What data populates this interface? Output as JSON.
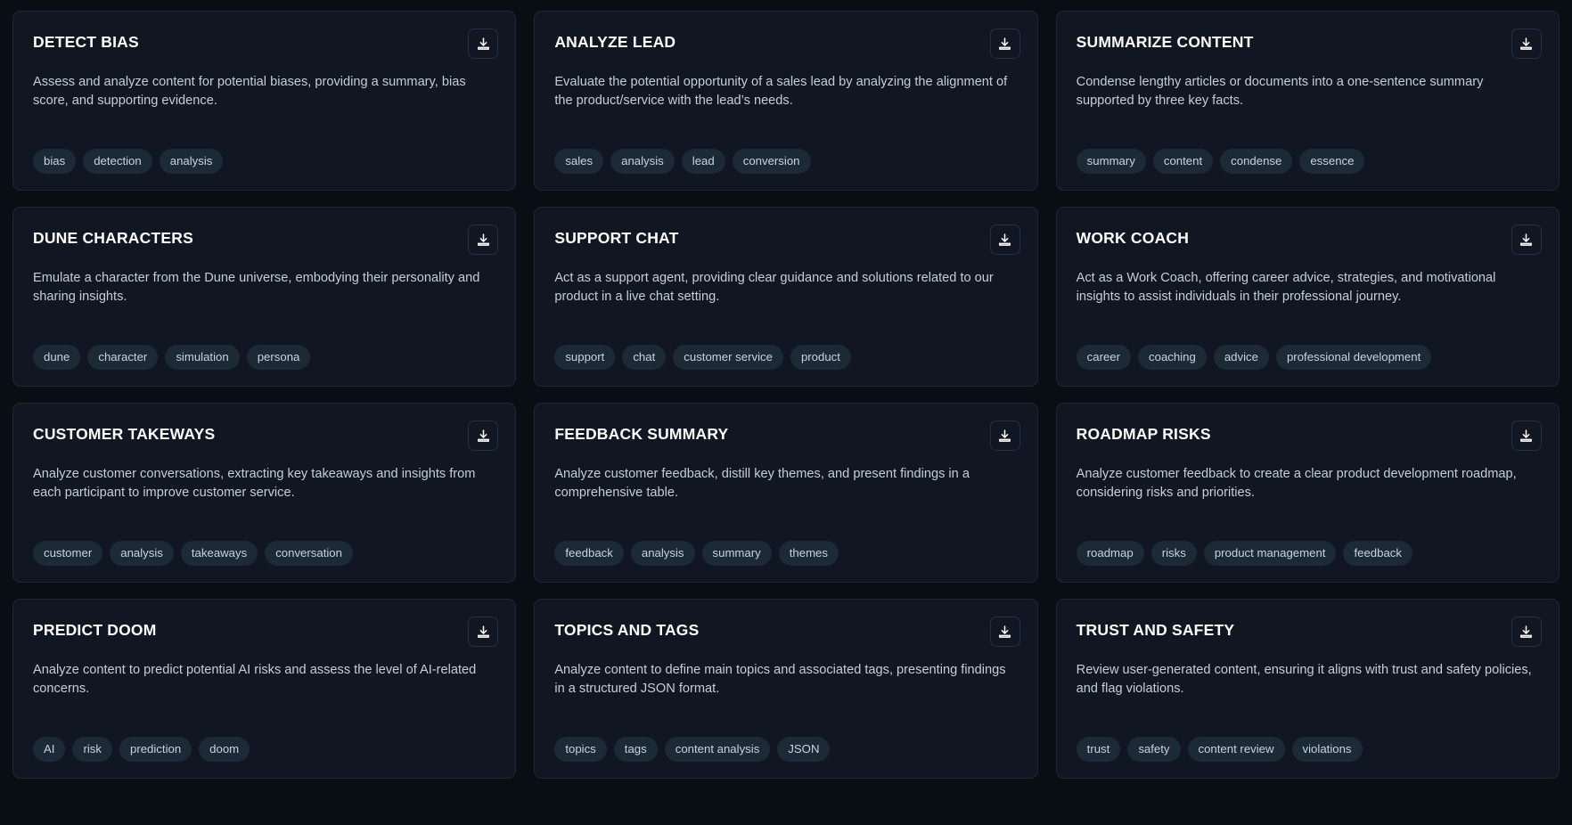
{
  "theme": {
    "page_background": "#090e15",
    "card_background": "#101722",
    "card_border": "#1d2836",
    "title_color": "#ffffff",
    "description_color": "#c3ced9",
    "tag_background": "#1c2936",
    "tag_text_color": "#c7d3de",
    "icon_color": "#ffffff"
  },
  "icons": {
    "download": "download-icon"
  },
  "cards": [
    {
      "title": "DETECT BIAS",
      "description": "Assess and analyze content for potential biases, providing a summary, bias score, and supporting evidence.",
      "tags": [
        "bias",
        "detection",
        "analysis"
      ],
      "download_label": "download-icon"
    },
    {
      "title": "ANALYZE LEAD",
      "description": "Evaluate the potential opportunity of a sales lead by analyzing the alignment of the product/service with the lead’s needs.",
      "tags": [
        "sales",
        "analysis",
        "lead",
        "conversion"
      ],
      "download_label": "download-icon"
    },
    {
      "title": "SUMMARIZE CONTENT",
      "description": "Condense lengthy articles or documents into a one-sentence summary supported by three key facts.",
      "tags": [
        "summary",
        "content",
        "condense",
        "essence"
      ],
      "download_label": "download-icon"
    },
    {
      "title": "DUNE CHARACTERS",
      "description": "Emulate a character from the Dune universe, embodying their personality and sharing insights.",
      "tags": [
        "dune",
        "character",
        "simulation",
        "persona"
      ],
      "download_label": "download-icon"
    },
    {
      "title": "SUPPORT CHAT",
      "description": "Act as a support agent, providing clear guidance and solutions related to our product in a live chat setting.",
      "tags": [
        "support",
        "chat",
        "customer service",
        "product"
      ],
      "download_label": "download-icon"
    },
    {
      "title": "WORK COACH",
      "description": "Act as a Work Coach, offering career advice, strategies, and motivational insights to assist individuals in their professional journey.",
      "tags": [
        "career",
        "coaching",
        "advice",
        "professional development"
      ],
      "download_label": "download-icon"
    },
    {
      "title": "CUSTOMER TAKEWAYS",
      "description": "Analyze customer conversations, extracting key takeaways and insights from each participant to improve customer service.",
      "tags": [
        "customer",
        "analysis",
        "takeaways",
        "conversation"
      ],
      "download_label": "download-icon"
    },
    {
      "title": "FEEDBACK SUMMARY",
      "description": "Analyze customer feedback, distill key themes, and present findings in a comprehensive table.",
      "tags": [
        "feedback",
        "analysis",
        "summary",
        "themes"
      ],
      "download_label": "download-icon"
    },
    {
      "title": "ROADMAP RISKS",
      "description": "Analyze customer feedback to create a clear product development roadmap, considering risks and priorities.",
      "tags": [
        "roadmap",
        "risks",
        "product management",
        "feedback"
      ],
      "download_label": "download-icon"
    },
    {
      "title": "PREDICT DOOM",
      "description": "Analyze content to predict potential AI risks and assess the level of AI-related concerns.",
      "tags": [
        "AI",
        "risk",
        "prediction",
        "doom"
      ],
      "download_label": "download-icon"
    },
    {
      "title": "TOPICS AND TAGS",
      "description": "Analyze content to define main topics and associated tags, presenting findings in a structured JSON format.",
      "tags": [
        "topics",
        "tags",
        "content analysis",
        "JSON"
      ],
      "download_label": "download-icon"
    },
    {
      "title": "TRUST AND SAFETY",
      "description": "Review user-generated content, ensuring it aligns with trust and safety policies, and flag violations.",
      "tags": [
        "trust",
        "safety",
        "content review",
        "violations"
      ],
      "download_label": "download-icon"
    }
  ]
}
